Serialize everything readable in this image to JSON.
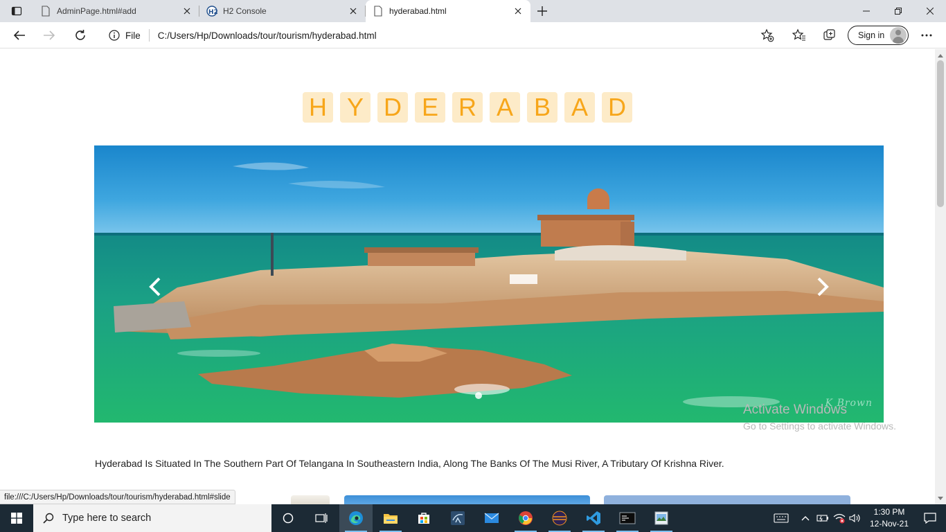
{
  "browser": {
    "tabs": [
      {
        "title": "AdminPage.html#add",
        "active": false,
        "icon": "page-icon"
      },
      {
        "title": "H2 Console",
        "active": false,
        "icon": "h2-icon"
      },
      {
        "title": "hyderabad.html",
        "active": true,
        "icon": "page-icon"
      }
    ],
    "address": {
      "scheme_label": "File",
      "url": "C:/Users/Hp/Downloads/tour/tourism/hyderabad.html"
    },
    "signin_label": "Sign in",
    "status_url": "file:///C:/Users/Hp/Downloads/tour/tourism/hyderabad.html#slide"
  },
  "page": {
    "title_letters": [
      "H",
      "Y",
      "D",
      "E",
      "R",
      "A",
      "B",
      "A",
      "D"
    ],
    "title_color": "#f7a61a",
    "slide_watermark": "K Brown",
    "description": "Hyderabad Is Situated In The Southern Part Of Telangana In Southeastern India, Along The Banks Of The Musi River, A Tributary Of Krishna River."
  },
  "overlay": {
    "activate_title": "Activate Windows",
    "activate_sub": "Go to Settings to activate Windows."
  },
  "taskbar": {
    "search_placeholder": "Type here to search",
    "time": "1:30 PM",
    "date": "12-Nov-21"
  },
  "colors": {
    "taskbar_bg": "#1c2a35",
    "tabstrip_bg": "#dee1e6",
    "title_tile_bg": "#fdebc8"
  }
}
